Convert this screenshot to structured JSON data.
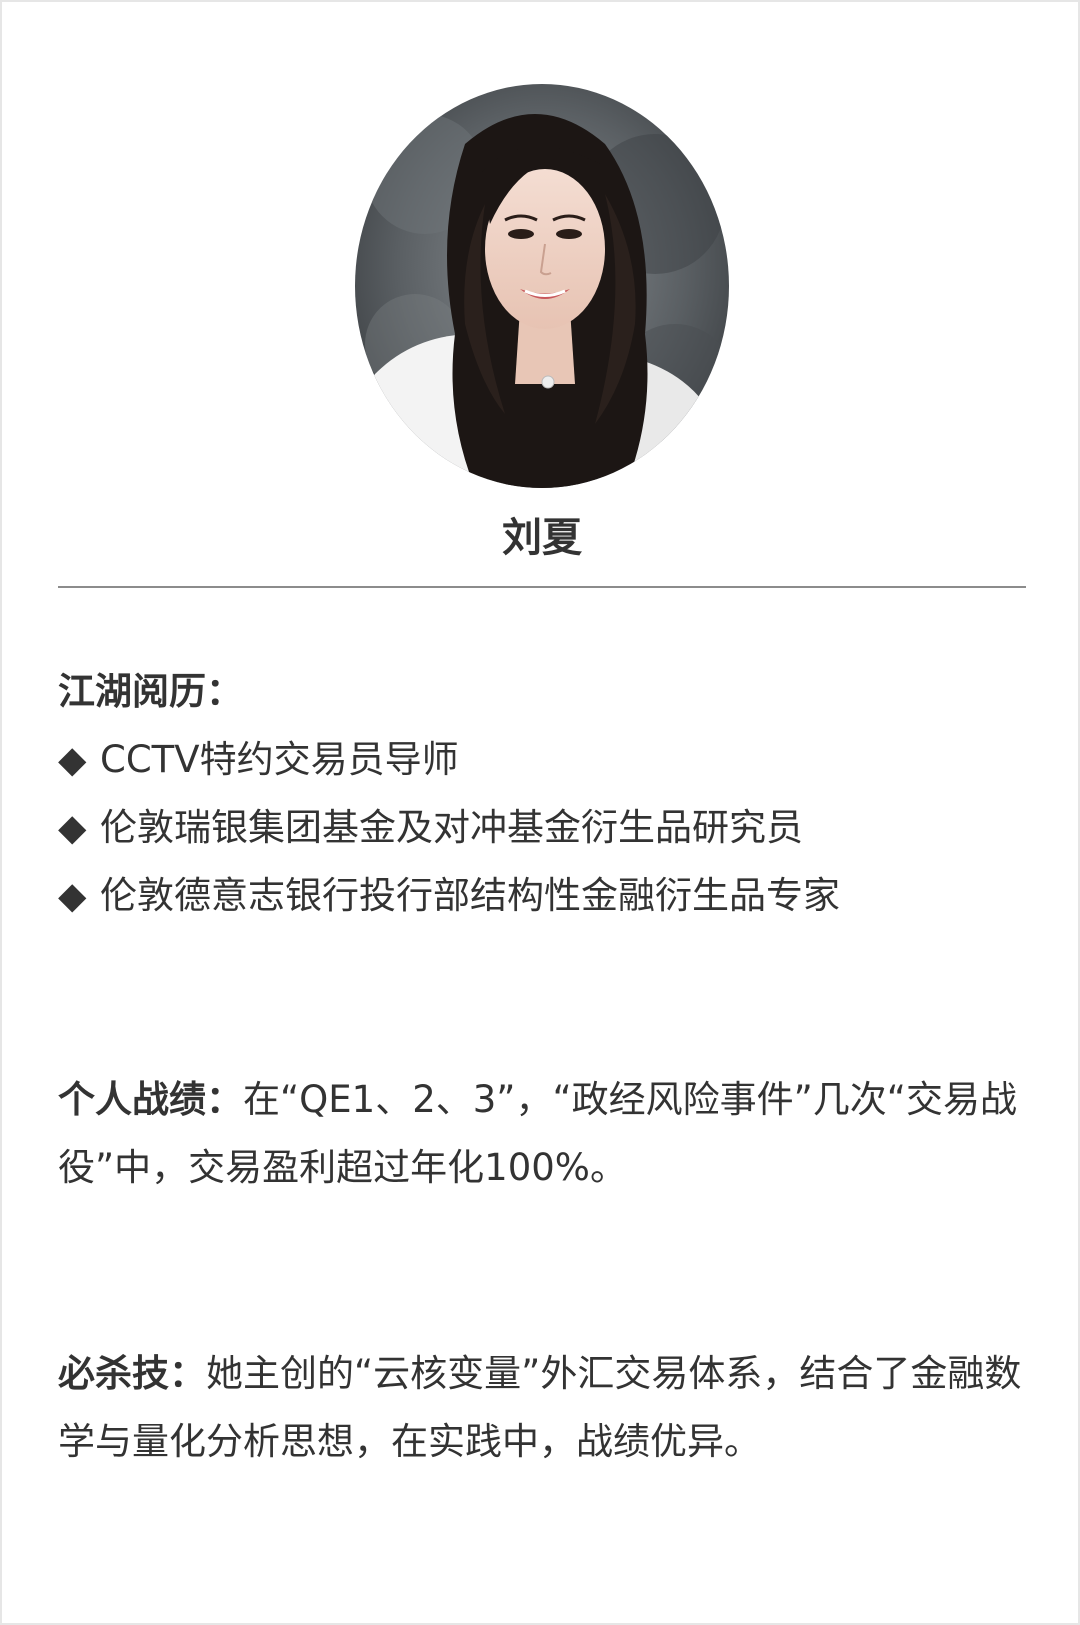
{
  "profile": {
    "name": "刘夏",
    "photo_alt": "portrait-photo"
  },
  "experience": {
    "label": "江湖阅历：",
    "bullet_icon": "diamond-bullet-icon",
    "items": [
      "CCTV特约交易员导师",
      "伦敦瑞银集团基金及对冲基金衍生品研究员",
      "伦敦德意志银行投行部结构性金融衍生品专家"
    ]
  },
  "record": {
    "label": "个人战绩：",
    "text": "在“QE1、2、3”，“政经风险事件”几次“交易战役”中，交易盈利超过年化100%。"
  },
  "skill": {
    "label": "必杀技：",
    "text": "她主创的“云核变量”外汇交易体系，结合了金融数学与量化分析思想，在实践中，战绩优异。"
  },
  "colors": {
    "text": "#333333",
    "divider": "#8c8c8c",
    "border": "#e6e6e6",
    "background": "#ffffff"
  }
}
